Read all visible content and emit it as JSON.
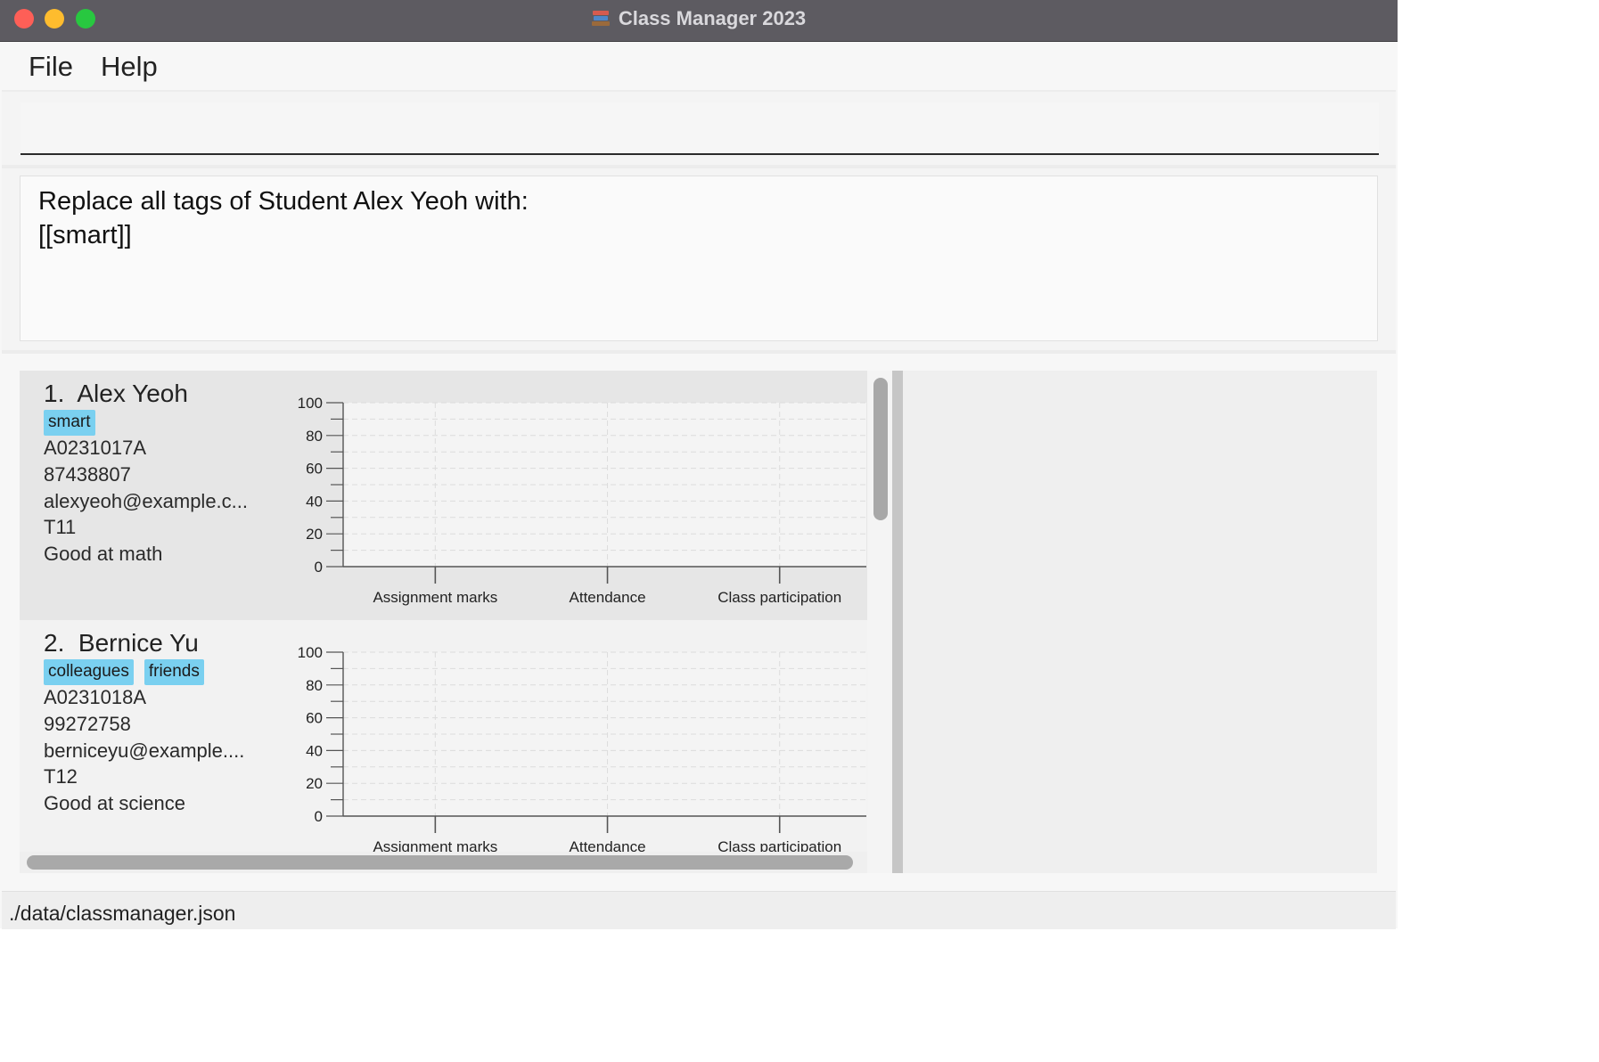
{
  "window": {
    "title": "Class Manager 2023",
    "app_icon": "stacked-books-icon"
  },
  "menu": {
    "file": "File",
    "help": "Help"
  },
  "command": {
    "value": "",
    "placeholder": ""
  },
  "result": {
    "line1": "Replace all tags of Student Alex Yeoh with:",
    "line2": "[[smart]]"
  },
  "students": [
    {
      "index": "1.",
      "name": "Alex Yeoh",
      "tags": [
        "smart"
      ],
      "student_number": "A0231017A",
      "phone": "87438807",
      "email": "alexyeoh@example.c...",
      "class_number": "T11",
      "comment": "Good at math"
    },
    {
      "index": "2.",
      "name": "Bernice Yu",
      "tags": [
        "colleagues",
        "friends"
      ],
      "student_number": "A0231018A",
      "phone": "99272758",
      "email": "berniceyu@example....",
      "class_number": "T12",
      "comment": "Good at science"
    }
  ],
  "chart_data": [
    {
      "type": "bar",
      "categories": [
        "Assignment marks",
        "Attendance",
        "Class participation"
      ],
      "values": [
        0,
        0,
        0
      ],
      "ylim": [
        0,
        100
      ],
      "yticks": [
        0,
        20,
        40,
        60,
        80,
        100
      ],
      "grid": true
    },
    {
      "type": "bar",
      "categories": [
        "Assignment marks",
        "Attendance",
        "Class participation"
      ],
      "values": [
        0,
        0,
        0
      ],
      "ylim": [
        0,
        100
      ],
      "yticks": [
        0,
        20,
        40,
        60,
        80,
        100
      ],
      "grid": true
    }
  ],
  "status": {
    "file_path": "./data/classmanager.json"
  },
  "colors": {
    "titlebar": "#5d5b61",
    "tag": "#7ad0f0",
    "selected_card": "#e6e6e6"
  }
}
